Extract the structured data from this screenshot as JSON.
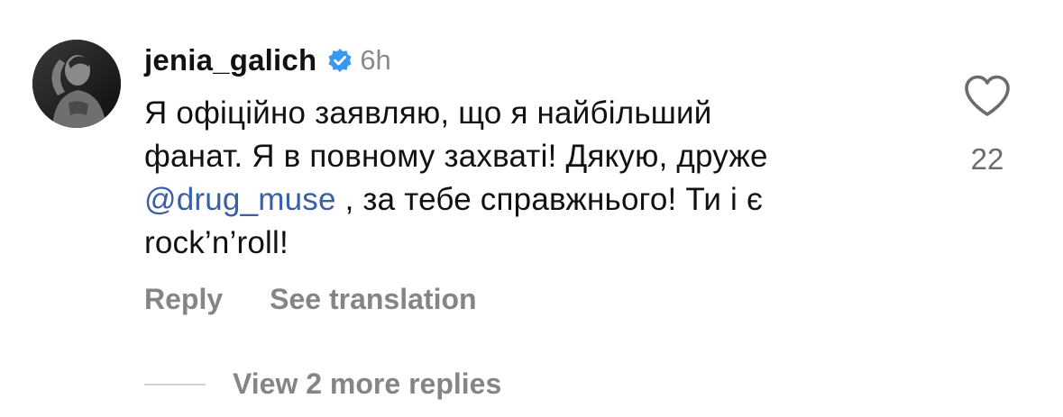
{
  "comment": {
    "username": "jenia_galich",
    "verified": true,
    "time": "6h",
    "text_line_1": "Я офіційно заявляю, що я найбільший",
    "text_line_2": "фанат. Я в повному захваті! Дякую, друже",
    "mention": "@drug_muse",
    "text_line_3_rest": " , за тебе справжнього! Ти і є",
    "text_line_4": "rock’n’roll!",
    "like_count": "22"
  },
  "actions": {
    "reply_label": "Reply",
    "translate_label": "See translation"
  },
  "replies": {
    "label": "View 2 more replies"
  },
  "icons": {
    "verified": "verified-badge-icon",
    "like": "heart-outline-icon"
  },
  "colors": {
    "verified_badge": "#3897f0",
    "mention": "#3a5fa8",
    "secondary_text": "#858589"
  }
}
